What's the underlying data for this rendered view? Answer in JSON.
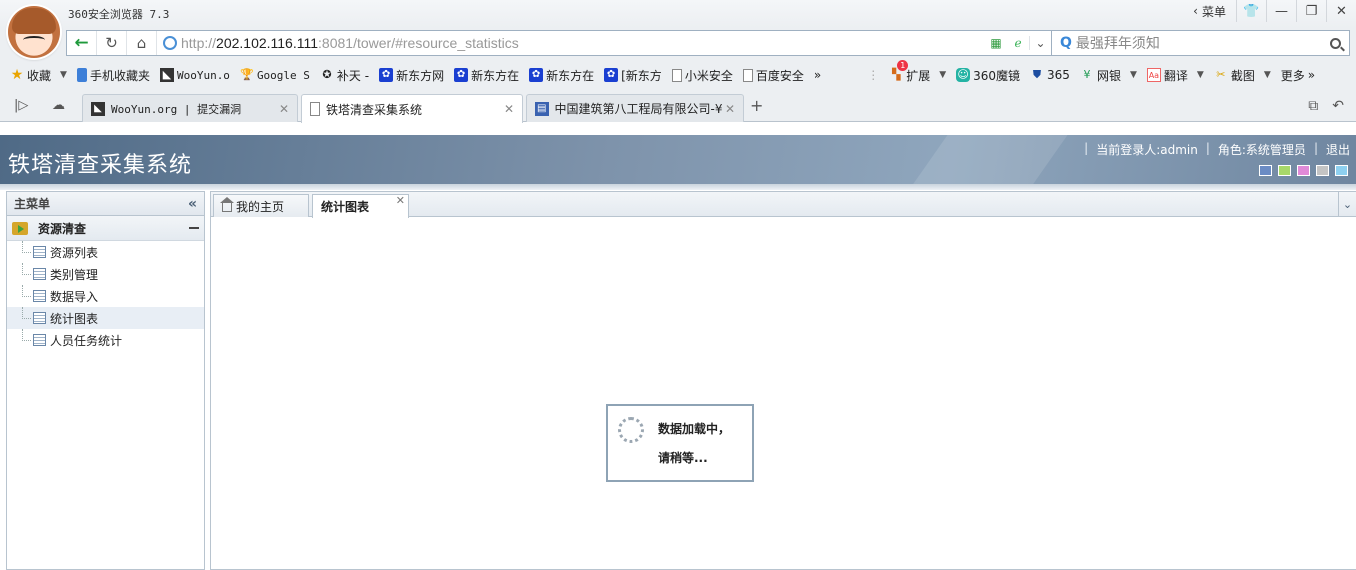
{
  "browser": {
    "app_title": "360安全浏览器 7.3",
    "menu_label": "菜单",
    "url_prefix": "http://",
    "url_host": "202.102.116.111",
    "url_rest": ":8081/tower/#resource_statistics",
    "search_placeholder": "最强拜年须知",
    "bookmarks": [
      {
        "label": "收藏",
        "icon": "star-icon"
      },
      {
        "label": "手机收藏夹",
        "icon": "phone-icon"
      },
      {
        "label": "WooYun.o",
        "icon": "wooyun-icon"
      },
      {
        "label": "Google S",
        "icon": "google-icon"
      },
      {
        "label": "补天 -",
        "icon": "butian-icon"
      },
      {
        "label": "新东方网",
        "icon": "paw-icon"
      },
      {
        "label": "新东方在",
        "icon": "paw-icon"
      },
      {
        "label": "新东方在",
        "icon": "paw-icon"
      },
      {
        "label": "[新东方",
        "icon": "paw-icon"
      },
      {
        "label": "小米安全",
        "icon": "page-icon"
      },
      {
        "label": "百度安全",
        "icon": "page-icon"
      }
    ],
    "toolbar_items": [
      {
        "label": "扩展",
        "badge": "1"
      },
      {
        "label": "360魔镜"
      },
      {
        "label": "365"
      },
      {
        "label": "网银"
      },
      {
        "label": "翻译"
      },
      {
        "label": "截图"
      },
      {
        "label": "更多"
      }
    ],
    "tabs": [
      {
        "label": "WooYun.org | 提交漏洞",
        "active": false
      },
      {
        "label": "铁塔清查采集系统",
        "active": true
      },
      {
        "label": "中国建筑第八工程局有限公司-¥",
        "active": false
      }
    ]
  },
  "app": {
    "title": "铁塔清查采集系统",
    "current_user": "当前登录人:admin",
    "role": "角色:系统管理员",
    "logout": "退出",
    "theme_colors": [
      "#6b8cc4",
      "#a8d86a",
      "#e08ad8",
      "#c4c4c4",
      "#8ed0f0"
    ],
    "sidebar": {
      "header": "主菜单",
      "group": "资源清查",
      "items": [
        {
          "label": "资源列表"
        },
        {
          "label": "类别管理"
        },
        {
          "label": "数据导入"
        },
        {
          "label": "统计图表",
          "active": true
        },
        {
          "label": "人员任务统计"
        }
      ]
    },
    "content_tabs": [
      {
        "label": "我的主页"
      },
      {
        "label": "统计图表",
        "active": true
      }
    ],
    "loading": {
      "line1": "数据加载中，",
      "line2": "请稍等..."
    }
  }
}
